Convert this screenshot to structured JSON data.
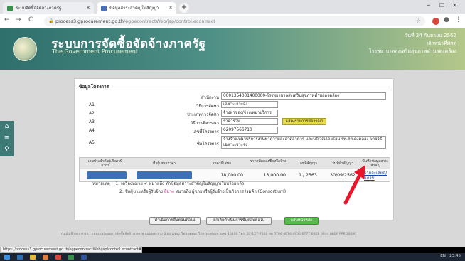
{
  "browser": {
    "tabs": [
      {
        "title": "ระบบจัดซื้อจัดจ้างภาครัฐ"
      },
      {
        "title": "ข้อมูลสาระสำคัญในสัญญา"
      }
    ],
    "new_tab": "+",
    "url_host": "process3.gprocurement.go.th",
    "url_path": "/egpecontractWeb/jsp/control.econtract",
    "back": "←",
    "forward": "→",
    "reload": "C",
    "status_url": "https://process3.gprocurement.go.th/egpecontractWeb/jsp/control.econtract#"
  },
  "header": {
    "title": "ระบบการจัดซื้อจัดจ้างภาครัฐ",
    "subtitle": "The Government Procurement",
    "date_text": "วันที่ 24 กันยายน 2562",
    "user_text": "เจ้าหน้าที่พัสดุ",
    "org_text": "โรงพยาบาลส่งเสริมสุขภาพตำบลดงคล้อง"
  },
  "side_nav": {
    "icons": [
      "home-icon",
      "menu-icon",
      "search-icon"
    ]
  },
  "project": {
    "section_title": "ข้อมูลโครงการ",
    "fields": [
      {
        "code": "",
        "label": "สำนักงาน",
        "value": "0001354001400000-โรงพยาบาลส่งเสริมสุขภาพตำบลดงคล้อง"
      },
      {
        "code": "A1",
        "label": "วิธีการจัดหา",
        "value": "เฉพาะเจาะจง"
      },
      {
        "code": "A2",
        "label": "ประเภทการจัดหา",
        "value": "จ้างทำของ/จ้างเหมาบริการ"
      },
      {
        "code": "A3",
        "label": "วิธีการพิจารณา",
        "value": "ราคารวม",
        "button": "แสดงรายการพิจารณา"
      },
      {
        "code": "A4",
        "label": "เลขที่โครงการ",
        "value": "62097566710"
      },
      {
        "code": "A5",
        "label": "ชื่อโครงการ",
        "value": "จ้างจ้างเหมาบริการงานทำความสะอาดอาคาร และบริเวณโดยรอบ รพ.สต.ดงคล้อง โดยวิธีเฉพาะเจาะจง"
      }
    ]
  },
  "table": {
    "headers": [
      "เลขประจำตัวผู้เสียภาษีอากร",
      "ชื่อผู้เสนอราคา",
      "ราคาที่เสนอ",
      "ราคาที่ตกลงซื้อหรือจ้าง",
      "เลขที่สัญญา",
      "วันที่ทำสัญญา",
      "บันทึกข้อมูลสาระสำคัญ"
    ],
    "rows": [
      {
        "tax_id": "",
        "bidder": "",
        "offered": "18,000.00",
        "agreed": "18,000.00",
        "contract_no": "1 / 2563",
        "contract_date": "30/09/2562",
        "link_line1": "รายละเอียด/",
        "link_line2": "แก้ไข"
      }
    ]
  },
  "notes": {
    "prefix": "หมายเหตุ :",
    "line1": "1. เครื่องหมาย ✓ หมายถึง ทำข้อมูลสาระสำคัญในสัญญาเรียบร้อยแล้ว",
    "line2_a": "2. ชื่อผู้ขายหรือผู้รับจ้าง",
    "line2_pink": "สีม่วง",
    "line2_b": "หมายถึง ผู้ขายหรือผู้รับจ้างเป็นกิจการร่วมค้า (Consortium)"
  },
  "actions": {
    "btn1": "ดำเนินการขั้นตอนต่อไป",
    "btn2": "ยกเลิกดำเนินการขั้นตอนต่อไป",
    "btn3": "กลับหน้าหลัก"
  },
  "footer": {
    "text": "กรมบัญชีกลาง (กวจ.) กลุ่มงานระบบการจัดซื้อจัดจ้างภาครัฐ ถนนพระราม 6 แขวงพญาไท เขตพญาไท กรุงเทพมหานคร 10400 โทร. 02-127-7000 ต่อ 6704 4674 4950 6777 6928 6934 6800   FPRO0090"
  },
  "taskbar": {
    "lang": "EN",
    "time": "23:45"
  },
  "colors": {
    "header_start": "#2f6f6c",
    "header_end": "#b5c78a",
    "accent_green": "#57b84b",
    "link": "#1a3fb0",
    "arrow": "#e8142a"
  }
}
